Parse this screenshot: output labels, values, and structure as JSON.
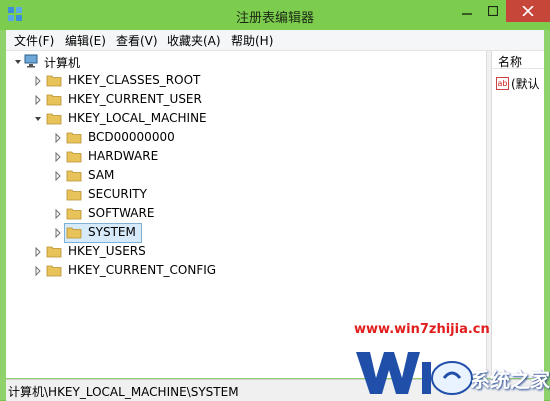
{
  "window": {
    "title": "注册表编辑器"
  },
  "menu": [
    "文件(F)",
    "编辑(E)",
    "查看(V)",
    "收藏夹(A)",
    "帮助(H)"
  ],
  "tree": {
    "root": "计算机",
    "hives": [
      {
        "label": "HKEY_CLASSES_ROOT"
      },
      {
        "label": "HKEY_CURRENT_USER"
      },
      {
        "label": "HKEY_LOCAL_MACHINE"
      },
      {
        "label": "BCD00000000"
      },
      {
        "label": "HARDWARE"
      },
      {
        "label": "SAM"
      },
      {
        "label": "SECURITY"
      },
      {
        "label": "SOFTWARE"
      },
      {
        "label": "SYSTEM",
        "selected": true
      },
      {
        "label": "HKEY_USERS"
      },
      {
        "label": "HKEY_CURRENT_CONFIG"
      }
    ]
  },
  "list": {
    "column_name": "名称",
    "first_value": "(默认"
  },
  "status": {
    "path": "计算机\\HKEY_LOCAL_MACHINE\\SYSTEM"
  },
  "watermark": {
    "url": "www.win7zhijia.cn",
    "site": "系统之家"
  },
  "colors": {
    "titlebar": "#7ccc4e",
    "close_button": "#c7463a",
    "selection_border": "#7fb2d8",
    "folder": "#e8c35a",
    "watermark_red": "#e21d1d"
  }
}
